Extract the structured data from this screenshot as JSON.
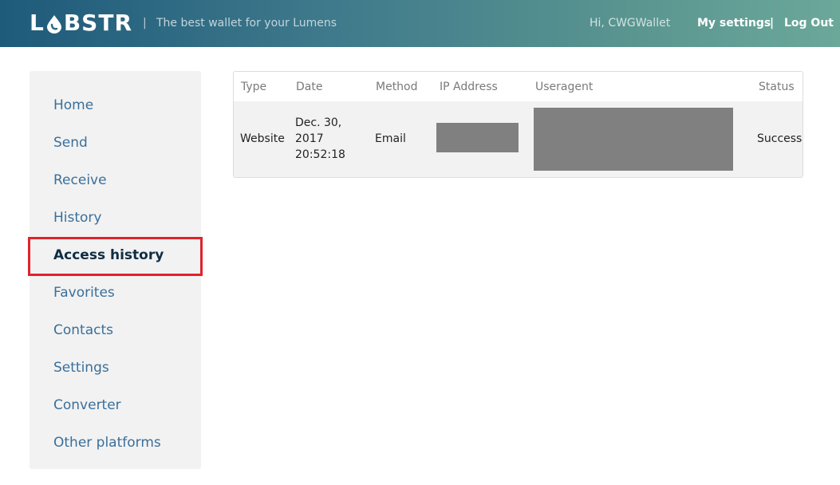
{
  "header": {
    "logo_text_left": "L",
    "logo_text_right": "BSTR",
    "separator": "|",
    "tagline": "The best wallet for your Lumens",
    "greeting": "Hi, CWGWallet",
    "my_settings": "My settings",
    "nav_separator": "|",
    "logout": "Log Out"
  },
  "sidebar": {
    "items": [
      {
        "label": "Home"
      },
      {
        "label": "Send"
      },
      {
        "label": "Receive"
      },
      {
        "label": "History"
      },
      {
        "label": "Access history"
      },
      {
        "label": "Favorites"
      },
      {
        "label": "Contacts"
      },
      {
        "label": "Settings"
      },
      {
        "label": "Converter"
      },
      {
        "label": "Other platforms"
      }
    ],
    "active": "Access history"
  },
  "table": {
    "columns": [
      "Type",
      "Date",
      "Method",
      "IP Address",
      "Useragent",
      "Status"
    ],
    "rows": [
      {
        "type": "Website",
        "date_line1": "Dec. 30,",
        "date_line2": "2017",
        "date_line3": "20:52:18",
        "method": "Email",
        "status": "Success"
      }
    ]
  },
  "colors": {
    "active_outline": "#e0232b",
    "link": "#3a6f9a",
    "active_text": "#0f2d44",
    "redaction": "#808080"
  }
}
